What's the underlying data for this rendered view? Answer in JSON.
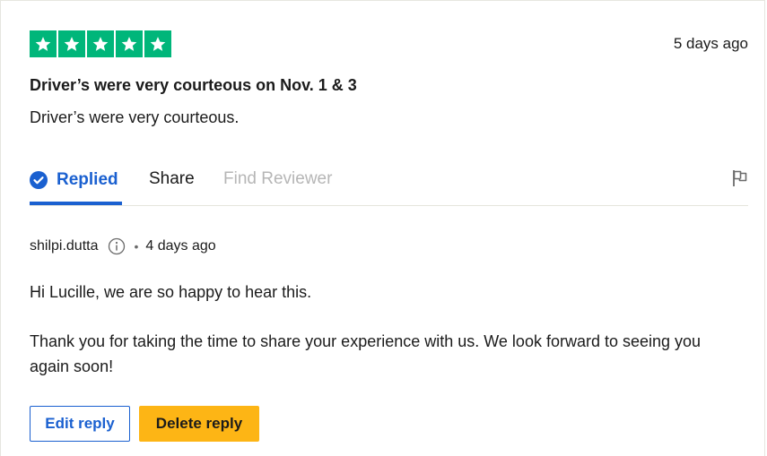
{
  "review": {
    "rating": 5,
    "date": "5 days ago",
    "title": "Driver’s were very courteous on Nov. 1 & 3",
    "text": "Driver’s were very courteous."
  },
  "tabs": {
    "replied": "Replied",
    "share": "Share",
    "find_reviewer": "Find Reviewer"
  },
  "reply": {
    "author": "shilpi.dutta",
    "separator": "•",
    "date": "4 days ago",
    "paragraph1": "Hi Lucille, we are so happy to hear this.",
    "paragraph2": "Thank you for taking the time to share your experience with us. We look forward to seeing you again soon!"
  },
  "buttons": {
    "edit_label": "Edit reply",
    "delete_label": "Delete reply"
  },
  "colors": {
    "star_green": "#00b67a",
    "accent_blue": "#1a60d0",
    "delete_yellow": "#fdb515"
  },
  "icons": {
    "star": "star-icon",
    "check": "check-circle-icon",
    "flag": "flag-icon",
    "info": "info-icon"
  }
}
